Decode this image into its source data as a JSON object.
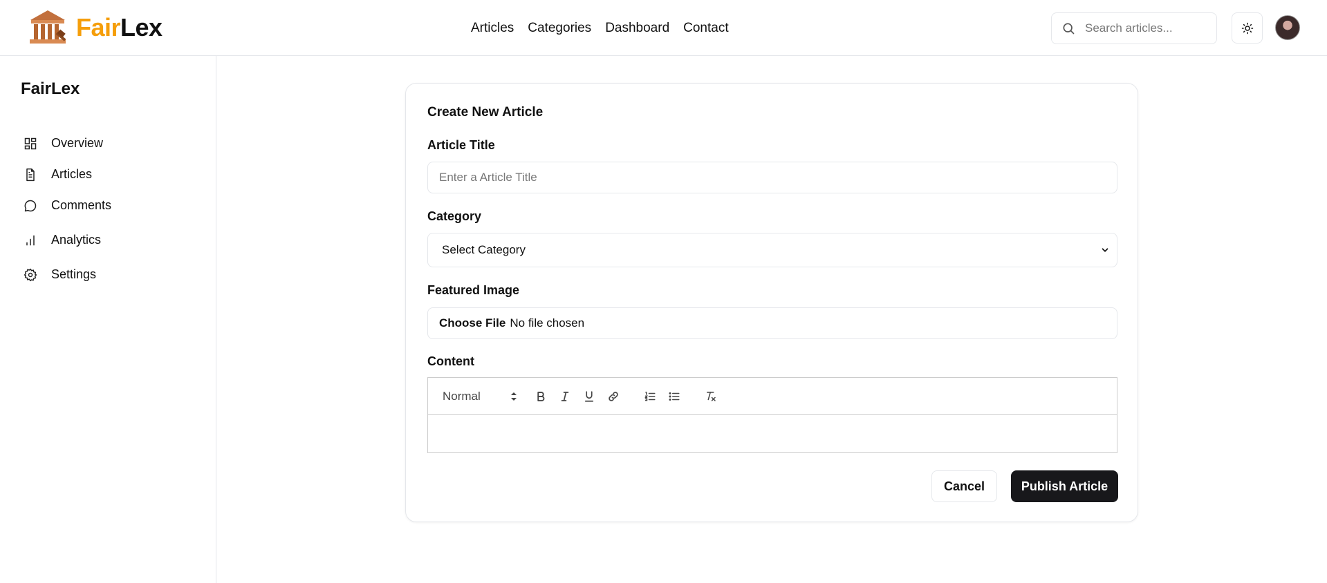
{
  "brand": {
    "part1": "Fair",
    "part2": "Lex",
    "logo_icon": "courthouse-icon"
  },
  "topnav": {
    "items": [
      "Articles",
      "Categories",
      "Dashboard",
      "Contact"
    ]
  },
  "search": {
    "placeholder": "Search articles...",
    "icon": "search-icon"
  },
  "header_actions": {
    "theme_icon": "sun-icon"
  },
  "sidebar": {
    "title": "FairLex",
    "items": [
      {
        "label": "Overview",
        "icon": "grid-icon"
      },
      {
        "label": "Articles",
        "icon": "document-icon"
      },
      {
        "label": "Comments",
        "icon": "chat-bubble-icon"
      },
      {
        "label": "Analytics",
        "icon": "bar-chart-icon"
      },
      {
        "label": "Settings",
        "icon": "gear-icon"
      }
    ]
  },
  "form": {
    "title": "Create New Article",
    "title_label": "Article Title",
    "title_placeholder": "Enter a Article Title",
    "category_label": "Category",
    "category_selected": "Select Category",
    "image_label": "Featured Image",
    "file_button": "Choose File",
    "file_status": "No file chosen",
    "content_label": "Content",
    "editor": {
      "format": "Normal"
    },
    "cancel_label": "Cancel",
    "publish_label": "Publish Article"
  },
  "colors": {
    "brand_accent": "#f59e0b",
    "primary_button": "#18181b",
    "border": "#e5e7eb"
  }
}
